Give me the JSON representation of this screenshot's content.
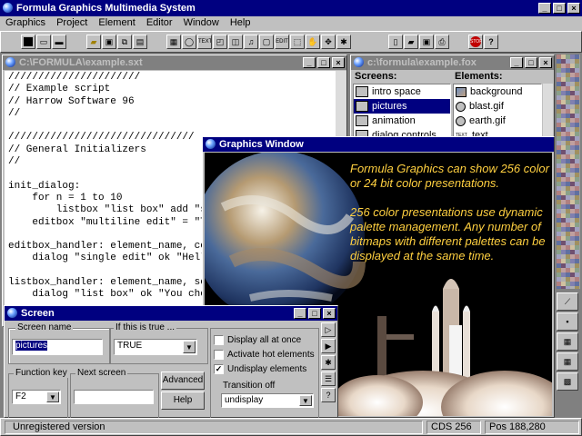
{
  "app": {
    "title": "Formula Graphics Multimedia System"
  },
  "menu": [
    {
      "label": "Graphics",
      "u": "G"
    },
    {
      "label": "Project",
      "u": "P"
    },
    {
      "label": "Element",
      "u": "E"
    },
    {
      "label": "Editor",
      "u": "E"
    },
    {
      "label": "Window",
      "u": "W"
    },
    {
      "label": "Help",
      "u": "H"
    }
  ],
  "script_window": {
    "title": "C:\\FORMULA\\example.sxt",
    "lines": [
      "//////////////////////",
      "// Example script",
      "// Harrow Software 96",
      "//",
      "",
      "///////////////////////////////",
      "// General Initializers",
      "//",
      "",
      "init_dialog:",
      "    for n = 1 to 10",
      "        listbox \"list box\" add \"se",
      "    editbox \"multiline edit\" = \"Th",
      "",
      "editbox_handler: element_name, con",
      "    dialog \"single edit\" ok \"Hello",
      "",
      "listbox_handler: element_name, sel",
      "    dialog \"list box\" ok \"You chos"
    ]
  },
  "project_window": {
    "title": "c:\\formula\\example.fox",
    "screens_header": "Screens:",
    "elements_header": "Elements:",
    "screens": [
      {
        "label": "intro space",
        "selected": false
      },
      {
        "label": "pictures",
        "selected": true
      },
      {
        "label": "animation",
        "selected": false
      },
      {
        "label": "dialog controls",
        "selected": false
      }
    ],
    "elements": [
      {
        "label": "background",
        "icon": "bitmap-icon"
      },
      {
        "label": "blast.gif",
        "icon": "ellipse-icon"
      },
      {
        "label": "earth.gif",
        "icon": "ellipse-icon"
      },
      {
        "label": "text",
        "icon": "text-icon"
      }
    ]
  },
  "graphics_window": {
    "title": "Graphics Window",
    "text1": "Formula Graphics can show 256 color or 24 bit color presentations.",
    "text2": "256 color presentations use dynamic palette management. Any number of bitmaps with different palettes can be displayed at the same time."
  },
  "screen_dialog": {
    "title": "Screen",
    "screen_name_label": "Screen name",
    "screen_name_value": "pictures",
    "if_true_label": "If this is true ...",
    "if_true_value": "TRUE",
    "function_key_label": "Function key",
    "function_key_value": "F2",
    "next_screen_label": "Next screen",
    "next_screen_value": "",
    "advanced_label": "Advanced",
    "help_label": "Help",
    "checkboxes": [
      {
        "label": "Display all at once",
        "checked": false
      },
      {
        "label": "Activate hot elements",
        "checked": false
      },
      {
        "label": "Undisplay elements",
        "checked": true
      }
    ],
    "transition_label": "Transition off",
    "transition_value": "undisplay"
  },
  "status": {
    "left": "Unregistered version",
    "colors": "CDS 256",
    "pos": "Pos 188,280"
  },
  "colors": {
    "titlebar": "#000080",
    "graphics_text": "#ffd040",
    "selection": "#000080"
  }
}
